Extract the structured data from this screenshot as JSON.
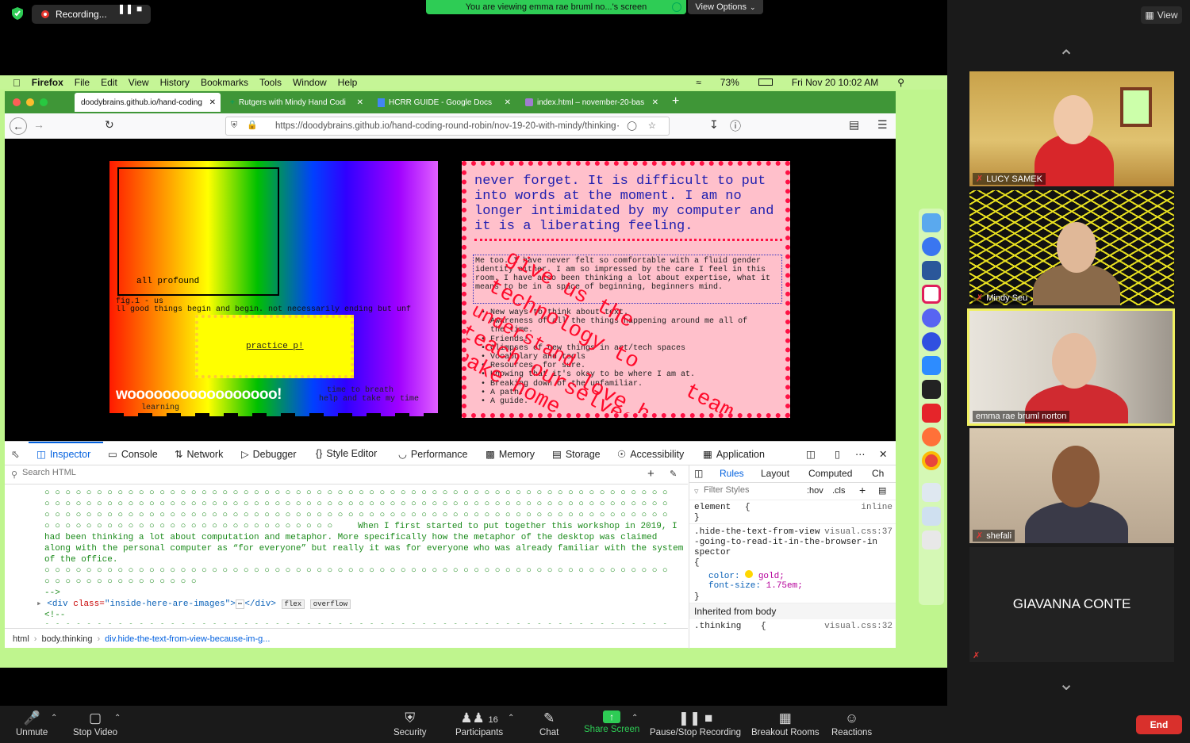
{
  "zoom": {
    "recording_label": "Recording...",
    "share_banner": "You are viewing emma rae bruml no...'s screen",
    "view_options": "View Options",
    "view_btn": "View"
  },
  "mac_menu": {
    "app": "Firefox",
    "items": [
      "File",
      "Edit",
      "View",
      "History",
      "Bookmarks",
      "Tools",
      "Window",
      "Help"
    ],
    "battery": "73%",
    "datetime": "Fri Nov 20  10:02 AM"
  },
  "browser": {
    "tabs": [
      {
        "label": "doodybrains.github.io/hand-coding"
      },
      {
        "label": "Rutgers with Mindy Hand Codi"
      },
      {
        "label": "HCRR GUIDE - Google Docs"
      },
      {
        "label": "index.html – november-20-bas"
      }
    ],
    "url": "https://doodybrains.github.io/hand-coding-round-robin/nov-19-20-with-mindy/thinking"
  },
  "page": {
    "all_profound": "all profound",
    "fig_label": "fig.1 - us",
    "good_things": "ll good things begin and begin. not necessarily ending but unf",
    "practice": "practice p!",
    "woo": "wooooooooooooooooo!",
    "time_breath": "time to breath",
    "help_take": "help and take my time",
    "learning": "learning",
    "pink_title": "never forget. It is difficult to put into words at the moment. I am no longer intimidated by my computer and it is a liberating feeling.",
    "pink_box": "Me too. I have never felt so comfortable with a fluid gender identity either. I am so impressed by the care I feel in this room. I have also been thinking a lot about expertise, what it means to be in a space of beginning, beginners mind.",
    "pink_list": [
      "New ways to think about text.",
      "Awareness of all the things happening around me all of",
      "  the time.",
      "Friends!",
      "Glimpses of new things in art/tech spaces",
      "Vocabulary and tools",
      "Resources, for sure.",
      "Knowing that it's okay to be where I am at.",
      "Breaking down of the unfamiliar.",
      "A path.",
      "A guide."
    ],
    "diag_1": "give us the",
    "diag_2": "technology to",
    "diag_3": "understand",
    "diag_4": "teach ourselves",
    "diag_5": "love how to",
    "diag_6": "make home",
    "diag_7": "team"
  },
  "devtools": {
    "tabs": [
      "Inspector",
      "Console",
      "Network",
      "Debugger",
      "Style Editor",
      "Performance",
      "Memory",
      "Storage",
      "Accessibility",
      "Application"
    ],
    "search_placeholder": "Search HTML",
    "html_text": "When I first started to put together this workshop in 2019, I had been thinking a lot about computation and metaphor. More specifically how the metaphor of the desktop was claimed along with the personal computer as “for everyone” but really it was for everyone who was already familiar with the system of the office.",
    "close_comment": "-->",
    "div_class_attr": "class=",
    "div_class_value": "\"inside-here-are-images\"",
    "badge_flex": "flex",
    "badge_overflow": "overflow",
    "open_comment": "<!--",
    "rules_tabs": [
      "Rules",
      "Layout",
      "Computed",
      "Ch"
    ],
    "filter_placeholder": "Filter Styles",
    "hov": ":hov",
    "cls": ".cls",
    "element_rule": "element",
    "inline": "inline",
    "selector": ".hide-the-text-from-view-because-im-going-to-read-it-in-the-browser-inspector",
    "source": "visual.css:37",
    "prop_color": "color:",
    "val_color": "gold;",
    "prop_size": "font-size:",
    "val_size": "1.75em;",
    "inherited": "Inherited from body",
    "thinking_selector": ".thinking",
    "thinking_source": "visual.css:32",
    "breadcrumbs": [
      "html",
      "body.thinking",
      "div.hide-the-text-from-view-because-im-g..."
    ]
  },
  "participants": [
    {
      "name": "LUCY SAMEK"
    },
    {
      "name": "Mindy Seu"
    },
    {
      "name": "emma rae bruml norton"
    },
    {
      "name": "shefali"
    },
    {
      "name": "GIAVANNA CONTE"
    }
  ],
  "toolbar": {
    "unmute": "Unmute",
    "stop_video": "Stop Video",
    "security": "Security",
    "participants": "Participants",
    "participants_count": "16",
    "chat": "Chat",
    "share_screen": "Share Screen",
    "pause_recording": "Pause/Stop Recording",
    "breakout": "Breakout Rooms",
    "reactions": "Reactions",
    "end": "End"
  },
  "colors": {
    "zoom_green": "#2ecc55",
    "desktop_green": "#bff58e",
    "firefox_tab_green": "#3f9637",
    "pink": "#ffc0cb",
    "devtools_blue": "#0060df",
    "end_red": "#d9302c"
  }
}
